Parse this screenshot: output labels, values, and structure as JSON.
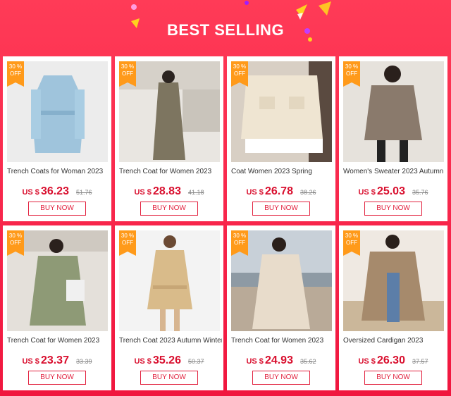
{
  "header": {
    "title": "BEST SELLING"
  },
  "colors": {
    "background": "#f7244a",
    "price": "#d90f2e",
    "badge": "#ff9a1a",
    "button": "#e2223f"
  },
  "products": [
    {
      "badge_pct": "30 %",
      "badge_off": "OFF",
      "name": "Trench Coats for Woman 2023",
      "currency": "US $",
      "price": "36.23",
      "old_price": "51.76",
      "button": "BUY NOW"
    },
    {
      "badge_pct": "30 %",
      "badge_off": "OFF",
      "name": "Trench Coat for Women 2023",
      "currency": "US $",
      "price": "28.83",
      "old_price": "41.18",
      "button": "BUY NOW"
    },
    {
      "badge_pct": "30 %",
      "badge_off": "OFF",
      "name": "Coat Women 2023 Spring",
      "currency": "US $",
      "price": "26.78",
      "old_price": "38.26",
      "button": "BUY NOW"
    },
    {
      "badge_pct": "30 %",
      "badge_off": "OFF",
      "name": "Women's Sweater 2023 Autumn",
      "currency": "US $",
      "price": "25.03",
      "old_price": "35.76",
      "button": "BUY NOW"
    },
    {
      "badge_pct": "30 %",
      "badge_off": "OFF",
      "name": "Trench Coat for Women 2023",
      "currency": "US $",
      "price": "23.37",
      "old_price": "33.39",
      "button": "BUY NOW"
    },
    {
      "badge_pct": "30 %",
      "badge_off": "OFF",
      "name": "Trench Coat 2023 Autumn Winter",
      "currency": "US $",
      "price": "35.26",
      "old_price": "50.37",
      "button": "BUY NOW"
    },
    {
      "badge_pct": "30 %",
      "badge_off": "OFF",
      "name": "Trench Coat for Women 2023",
      "currency": "US $",
      "price": "24.93",
      "old_price": "35.62",
      "button": "BUY NOW"
    },
    {
      "badge_pct": "30 %",
      "badge_off": "OFF",
      "name": "Oversized Cardigan  2023",
      "currency": "US $",
      "price": "26.30",
      "old_price": "37.57",
      "button": "BUY NOW"
    }
  ]
}
